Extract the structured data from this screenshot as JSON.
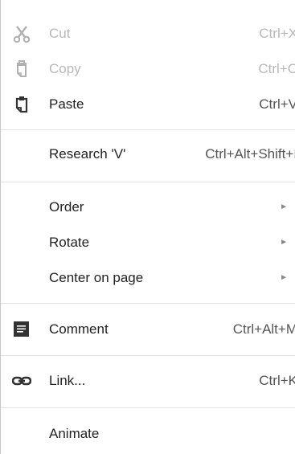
{
  "menu": {
    "items": [
      {
        "label": "Cut",
        "shortcut": "Ctrl+X",
        "icon": "scissors-icon",
        "disabled": true
      },
      {
        "label": "Copy",
        "shortcut": "Ctrl+C",
        "icon": "copy-icon",
        "disabled": true
      },
      {
        "label": "Paste",
        "shortcut": "Ctrl+V",
        "icon": "clipboard-icon",
        "disabled": false
      },
      {
        "label": "Research 'V'",
        "shortcut": "Ctrl+Alt+Shift+I",
        "disabled": false
      },
      {
        "label": "Order",
        "submenu_arrow": "►",
        "disabled": false
      },
      {
        "label": "Rotate",
        "submenu_arrow": "►",
        "disabled": false
      },
      {
        "label": "Center on page",
        "submenu_arrow": "►",
        "disabled": false
      },
      {
        "label": "Comment",
        "shortcut": "Ctrl+Alt+M",
        "icon": "comment-icon",
        "disabled": false
      },
      {
        "label": "Link...",
        "shortcut": "Ctrl+K",
        "icon": "link-icon",
        "disabled": false
      },
      {
        "label": "Animate",
        "disabled": false
      }
    ]
  },
  "colors": {
    "text": "#222222",
    "disabled_text": "#b8b8b8",
    "shortcut_text": "#555555",
    "separator": "#e3e3e3",
    "border": "#c8c8c8"
  }
}
